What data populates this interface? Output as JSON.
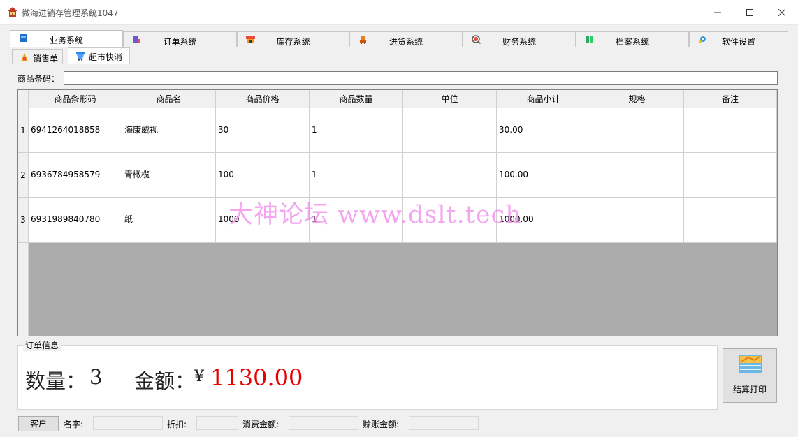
{
  "window": {
    "title": "微海进销存管理系统1047",
    "minimize_icon": "minimize-icon",
    "maximize_icon": "maximize-icon",
    "close_icon": "close-icon"
  },
  "main_tabs": [
    {
      "label": "业务系统",
      "icon": "business-icon",
      "active": true
    },
    {
      "label": "订单系统",
      "icon": "order-icon"
    },
    {
      "label": "库存系统",
      "icon": "inventory-icon"
    },
    {
      "label": "进货系统",
      "icon": "purchase-icon"
    },
    {
      "label": "财务系统",
      "icon": "finance-icon"
    },
    {
      "label": "档案系统",
      "icon": "archive-icon"
    },
    {
      "label": "软件设置",
      "icon": "settings-icon"
    }
  ],
  "sub_tabs": [
    {
      "label": "销售单",
      "icon": "sales-icon"
    },
    {
      "label": "超市快消",
      "icon": "supermarket-icon",
      "active": true
    }
  ],
  "barcode": {
    "label": "商品条码：",
    "value": ""
  },
  "table": {
    "columns": [
      "商品条形码",
      "商品名",
      "商品价格",
      "商品数量",
      "单位",
      "商品小计",
      "规格",
      "备注"
    ],
    "rows": [
      {
        "index": "1",
        "cells": [
          "6941264018858",
          "海康威视",
          "30",
          "1",
          "",
          "30.00",
          "",
          ""
        ]
      },
      {
        "index": "2",
        "cells": [
          "6936784958579",
          "青橄榄",
          "100",
          "1",
          "",
          "100.00",
          "",
          ""
        ]
      },
      {
        "index": "3",
        "cells": [
          "6931989840780",
          "纸",
          "1000",
          "1",
          "",
          "1000.00",
          "",
          ""
        ]
      }
    ]
  },
  "watermark": "大神论坛  www.dslt.tech",
  "order_info": {
    "legend": "订单信息",
    "quantity_label": "数量：",
    "quantity": "3",
    "amount_label": "金额：",
    "currency": "¥",
    "amount": "1130.00",
    "amount_color": "#e60000"
  },
  "checkout_button": {
    "label": "结算打印",
    "icon": "checkout-print-icon"
  },
  "customer": {
    "button_label": "客户",
    "name_label": "名字:",
    "name_value": "",
    "discount_label": "折扣:",
    "discount_value": "",
    "consumption_label": "消费金额:",
    "consumption_value": "",
    "credit_label": "赊账金额:",
    "credit_value": ""
  }
}
